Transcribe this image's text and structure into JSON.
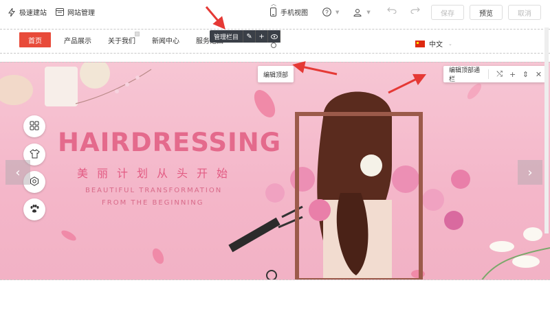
{
  "toolbar": {
    "quick_build": "极速建站",
    "site_manage": "网站管理",
    "mobile_view": "手机视图",
    "save_label": "保存",
    "preview_label": "预览",
    "cancel_label": "取消"
  },
  "nav": {
    "items": [
      "首页",
      "产品展示",
      "关于我们",
      "新闻中心",
      "服务范围"
    ],
    "language": "中文"
  },
  "manage_toolbar": {
    "label": "管理栏目"
  },
  "banner": {
    "title": "HAIRDRESSING",
    "subtitle_cn": "美丽计划从头开始",
    "subtitle_en_1": "BEAUTIFUL TRANSFORMATION",
    "subtitle_en_2": "FROM THE BEGINNING",
    "edit_top_label": "编辑顶部",
    "edit_top_bar_label": "编辑顶部通栏"
  },
  "colors": {
    "accent": "#e84b3a",
    "banner_bg": "#f4b6c9",
    "hero_text": "#e46a8c",
    "annotation_arrow": "#e53935"
  },
  "icons": {
    "sidebar": [
      "grid-icon",
      "shirt-icon",
      "settings-icon",
      "paw-icon"
    ]
  }
}
